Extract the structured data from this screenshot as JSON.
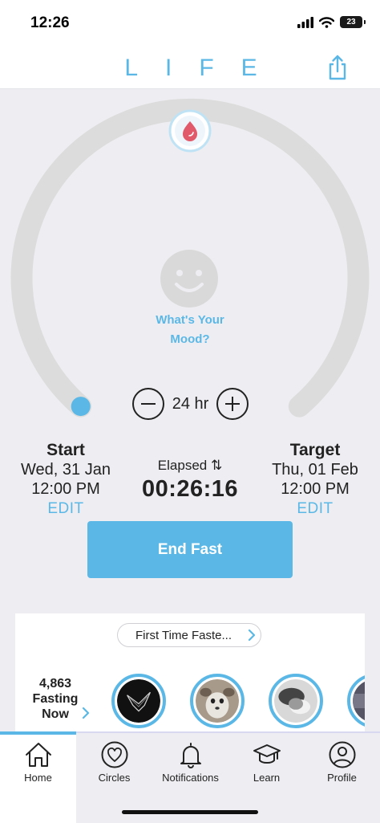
{
  "status": {
    "time": "12:26",
    "battery": "23"
  },
  "header": {
    "logo_letters": "LIFE"
  },
  "mood": {
    "prompt_line1": "What's Your",
    "prompt_line2": "Mood?"
  },
  "duration": {
    "label": "24 hr"
  },
  "start": {
    "heading": "Start",
    "date": "Wed, 31 Jan",
    "time": "12:00 PM",
    "edit": "EDIT"
  },
  "elapsed": {
    "label": "Elapsed ⇅",
    "value": "00:26:16"
  },
  "target": {
    "heading": "Target",
    "date": "Thu, 01 Feb",
    "time": "12:00 PM",
    "edit": "EDIT"
  },
  "end_button": {
    "label": "End Fast"
  },
  "community": {
    "pill_label": "First Time Faste...",
    "fasting_count": "4,863",
    "fasting_line2": "Fasting",
    "fasting_line3": "Now"
  },
  "tabs": [
    {
      "label": "Home",
      "icon": "home-icon"
    },
    {
      "label": "Circles",
      "icon": "heart-circle-icon"
    },
    {
      "label": "Notifications",
      "icon": "bell-icon"
    },
    {
      "label": "Learn",
      "icon": "graduation-cap-icon"
    },
    {
      "label": "Profile",
      "icon": "person-icon"
    }
  ],
  "colors": {
    "accent": "#5bb8e6",
    "ring": "#dcdcdc",
    "background": "#eeeef2",
    "brand_dot": "#e05a6b"
  }
}
